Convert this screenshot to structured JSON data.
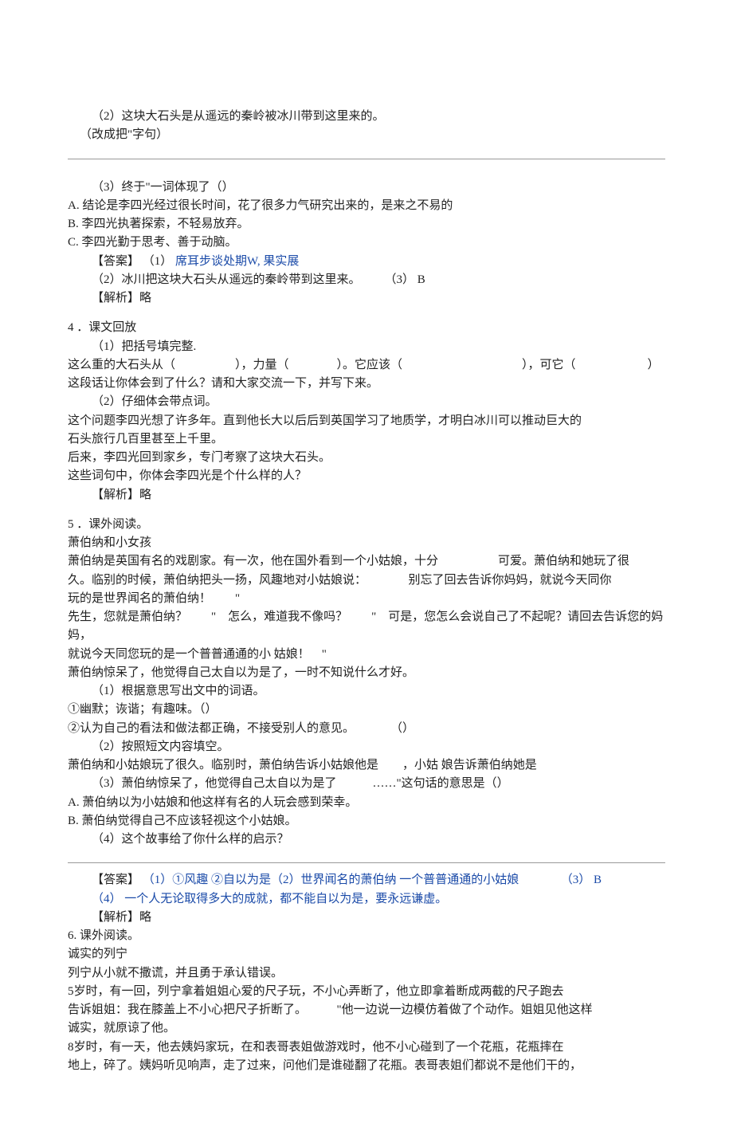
{
  "q2": {
    "prompt": "（2）这块大石头是从遥远的秦岭被冰川带到这里来的。",
    "instruction": "（改成把\"字句）"
  },
  "q3": {
    "prompt": "（3）终于\"一词体现了（）",
    "optA": "A. 结论是李四光经过很长时间，花了很多力气研究出来的，是来之不易的",
    "optB": "B. 李四光执著探索，不轻易放弃。",
    "optC": "C. 李四光勤于思考、善于动脑。",
    "ans_label": "【答案】",
    "ans1_pre": "（1）",
    "ans1_blue": "席耳步谈处期W, 果实展",
    "ans2": "（2）冰川把这块大石头从遥远的秦岭带到这里来。　　　（3） B",
    "jiexi": "【解析】略"
  },
  "q4": {
    "title": "4 ．课文回放",
    "p1": "（1）把括号填完整.",
    "line1a": "这么重的大石头从（　　　　　），力量（　　　　）。它应该（　　　　　　　　　　），可它（　　　　　　）",
    "line2": "这段话让你体会到了什么？请和大家交流一下，并写下来。",
    "p2": "（2）仔细体会带点词。",
    "text1": "这个问题李四光想了许多年。直到他长大以后后到英国学习了地质学，才明白冰川可以推动巨大的",
    "text2": "石头旅行几百里甚至上千里。",
    "text3": "后来，李四光回到家乡，专门考察了这块大石头。",
    "text4": "这些词句中，你体会李四光是个什么样的人？",
    "jiexi": "【解析】略"
  },
  "q5": {
    "title": "5 ．课外阅读。",
    "h": "萧伯纳和小女孩",
    "p1a": "萧伯纳是英国有名的戏剧家。有一次，他在国外看到一个小姑娘，十分　　　　　可爱。萧伯纳和她玩了很",
    "p1b": "久。临别的时候，萧伯纳把头一扬，风趣地对小姑娘说：　　　　别忘了回去告诉你妈妈，就说今天同你",
    "p1c": "玩的是世界闻名的萧伯纳！　　\"",
    "p2a": "先生，您就是萧伯纳？　　\"　怎么，难道我不像吗？　　\"　可是，您怎么会说自己了不起呢？请回去告诉您的妈妈，",
    "p2b": "就说今天同您玩的是一个普普通通的小 姑娘！　\"",
    "p3": "萧伯纳惊呆了，他觉得自己太自以为是了，一时不知说什么才好。",
    "q1": "（1）根据意思写出文中的词语。",
    "q1a": "①幽默；诙谐；有趣味。（）",
    "q1b": "②认为自己的看法和做法都正确，不接受别人的意见。　　　　（）",
    "q2": "（2）按照短文内容填空。",
    "q2a": "萧伯纳和小姑娘玩了很久。临别时，萧伯纳告诉小姑娘他是　　，小姑 娘告诉萧伯纳她是",
    "q3": "（3）萧伯纳惊呆了，他觉得自己太自以为是了　　　……\"这句话的意思是（）",
    "q3a": "A. 萧伯纳以为小姑娘和他这样有名的人玩会感到荣幸。",
    "q3b": "B. 萧伯纳觉得自己不应该轻视这个小姑娘。",
    "q4": "（4）这个故事给了你什么样的启示？",
    "ans_label": "【答案】",
    "ans_blue": "（1）①风趣 ②自以为是（2）世界闻名的萧伯纳 一个普普通通的小姑娘　　　　（3） B",
    "ans2": "（4） 一个人无论取得多大的成就，都不能自以为是，要永远谦虚。",
    "jiexi": "【解析】略"
  },
  "q6": {
    "title": "6. 课外阅读。",
    "h": "诚实的列宁",
    "p1": "列宁从小就不撒谎，并且勇于承认错误。",
    "p2a": "5岁时，有一回，列宁拿着姐姐心爱的尺子玩，不小心弄断了，他立即拿着断成两截的尺子跑去",
    "p2b": "告诉姐姐：我在膝盖上不小心把尺子折断了。　　　\"他一边说一边模仿着做了个动作。姐姐见他这样",
    "p2c": "诚实，就原谅了他。",
    "p3a": "8岁时，有一天，他去姨妈家玩，在和表哥表姐做游戏时，他不小心碰到了一个花瓶，花瓶摔在",
    "p3b": "地上，碎了。姨妈听见响声，走了过来，问他们是谁碰翻了花瓶。表哥表姐们都说不是他们干的，"
  }
}
